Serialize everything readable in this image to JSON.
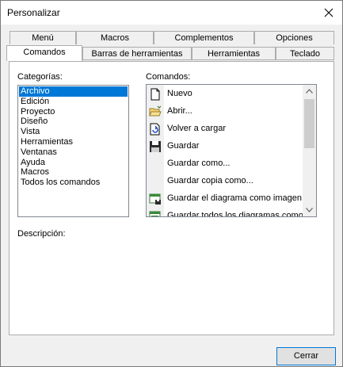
{
  "window": {
    "title": "Personalizar"
  },
  "tabs": {
    "row1": [
      {
        "label": "Menú"
      },
      {
        "label": "Macros"
      },
      {
        "label": "Complementos"
      },
      {
        "label": "Opciones"
      }
    ],
    "row2": [
      {
        "label": "Comandos",
        "selected": true
      },
      {
        "label": "Barras de herramientas"
      },
      {
        "label": "Herramientas"
      },
      {
        "label": "Teclado"
      }
    ]
  },
  "categories": {
    "label": "Categorías:",
    "items": [
      "Archivo",
      "Edición",
      "Proyecto",
      "Diseño",
      "Vista",
      "Herramientas",
      "Ventanas",
      "Ayuda",
      "Macros",
      "Todos los comandos"
    ],
    "selected_index": 0
  },
  "commands": {
    "label": "Comandos:",
    "items": [
      {
        "label": "Nuevo",
        "icon": "new-document-icon"
      },
      {
        "label": "Abrir...",
        "icon": "open-folder-icon"
      },
      {
        "label": "Volver a cargar",
        "icon": "reload-icon"
      },
      {
        "label": "Guardar",
        "icon": "save-icon"
      },
      {
        "label": "Guardar como...",
        "icon": ""
      },
      {
        "label": "Guardar copia como...",
        "icon": ""
      },
      {
        "label": "Guardar el diagrama como imagen...",
        "icon": "save-diagram-image-icon"
      },
      {
        "label": "Guardar todos los diagramas como i",
        "icon": "save-all-diagrams-icon"
      }
    ]
  },
  "description": {
    "label": "Descripción:"
  },
  "buttons": {
    "close": "Cerrar"
  }
}
